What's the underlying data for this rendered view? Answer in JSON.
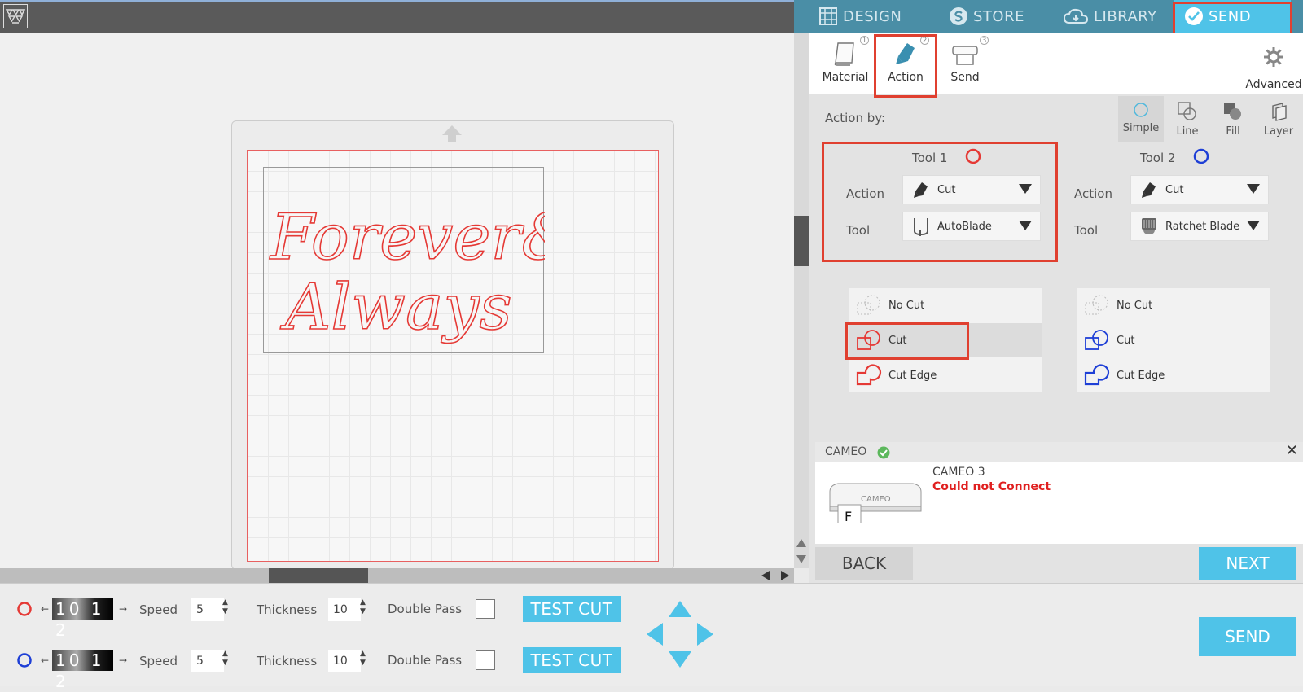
{
  "nav": {
    "tabs": [
      {
        "label": "DESIGN",
        "icon": "grid-icon"
      },
      {
        "label": "STORE",
        "icon": "store-s-icon"
      },
      {
        "label": "LIBRARY",
        "icon": "cloud-icon"
      },
      {
        "label": "SEND",
        "icon": "check-circle-icon"
      }
    ],
    "active": "SEND"
  },
  "steps": {
    "items": [
      {
        "label": "Material",
        "badge": "1"
      },
      {
        "label": "Action",
        "badge": "2"
      },
      {
        "label": "Send",
        "badge": "3"
      }
    ],
    "advanced_label": "Advanced"
  },
  "action_by": {
    "label": "Action by:",
    "modes": [
      "Simple",
      "Line",
      "Fill",
      "Layer"
    ],
    "active_mode": "Simple"
  },
  "tool1": {
    "title": "Tool 1",
    "color": "#e53935",
    "action_label": "Action",
    "action_value": "Cut",
    "tool_label": "Tool",
    "tool_value": "AutoBlade",
    "options": [
      "No Cut",
      "Cut",
      "Cut Edge"
    ],
    "selected": "Cut"
  },
  "tool2": {
    "title": "Tool 2",
    "color": "#1e3fd6",
    "action_label": "Action",
    "action_value": "Cut",
    "tool_label": "Tool",
    "tool_value": "Ratchet Blade",
    "options": [
      "No Cut",
      "Cut",
      "Cut Edge"
    ]
  },
  "device": {
    "bar_label": "CAMEO",
    "name": "CAMEO 3",
    "status": "Could not Connect",
    "status_color": "#e02020",
    "image_text": "CAMEO",
    "image_letter": "F"
  },
  "footer_nav": {
    "back": "BACK",
    "next": "NEXT"
  },
  "bottom": {
    "rows": [
      {
        "color": "#e53935",
        "depth": "10 1 2",
        "speed_label": "Speed",
        "speed": "5",
        "thickness_label": "Thickness",
        "thickness": "10",
        "double_pass_label": "Double Pass",
        "test_cut": "TEST CUT"
      },
      {
        "color": "#1e3fd6",
        "depth": "10 1 2",
        "speed_label": "Speed",
        "speed": "5",
        "thickness_label": "Thickness",
        "thickness": "10",
        "double_pass_label": "Double Pass",
        "test_cut": "TEST CUT"
      }
    ],
    "send": "SEND"
  },
  "design": {
    "line1": "Forever&",
    "line2": "Always",
    "color": "#e53935"
  }
}
